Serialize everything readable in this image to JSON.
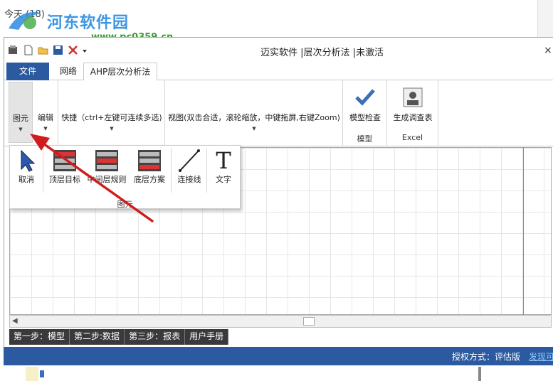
{
  "background": {
    "today_label": "今天 (18)"
  },
  "watermark": {
    "title": "河东软件园",
    "url": "www.pc0359.cn"
  },
  "window": {
    "title": "迈实软件 |层次分析法 |未激活",
    "close_glyph": "×"
  },
  "tabs": [
    {
      "label": "文件"
    },
    {
      "label": "网络"
    },
    {
      "label": "AHP层次分析法"
    }
  ],
  "ribbon": {
    "element": "图元",
    "edit": "编辑",
    "shortcut": "快捷（ctrl+左键可连续多选)",
    "view": "视图(双击合适，滚轮缩放，中键拖屏,右键Zoom)",
    "model_check": "模型检查",
    "model_group": "模型",
    "survey": "生成调查表",
    "excel_group": "Excel"
  },
  "popup": {
    "items": [
      {
        "label": "取消"
      },
      {
        "label": "顶层目标"
      },
      {
        "label": "中间层规则"
      },
      {
        "label": "底层方案"
      },
      {
        "label": "连接线"
      },
      {
        "label": "文字"
      }
    ],
    "caption": "图元",
    "text_glyph": "T"
  },
  "steps": [
    {
      "label": "第一步：模型"
    },
    {
      "label": "第二步:数据"
    },
    {
      "label": "第三步：报表"
    },
    {
      "label": "用户手册"
    }
  ],
  "status": {
    "auth": "授权方式：评估版",
    "link": "发现可"
  },
  "colors": {
    "accent": "#2c5aa0",
    "arrow": "#d01c1c"
  }
}
